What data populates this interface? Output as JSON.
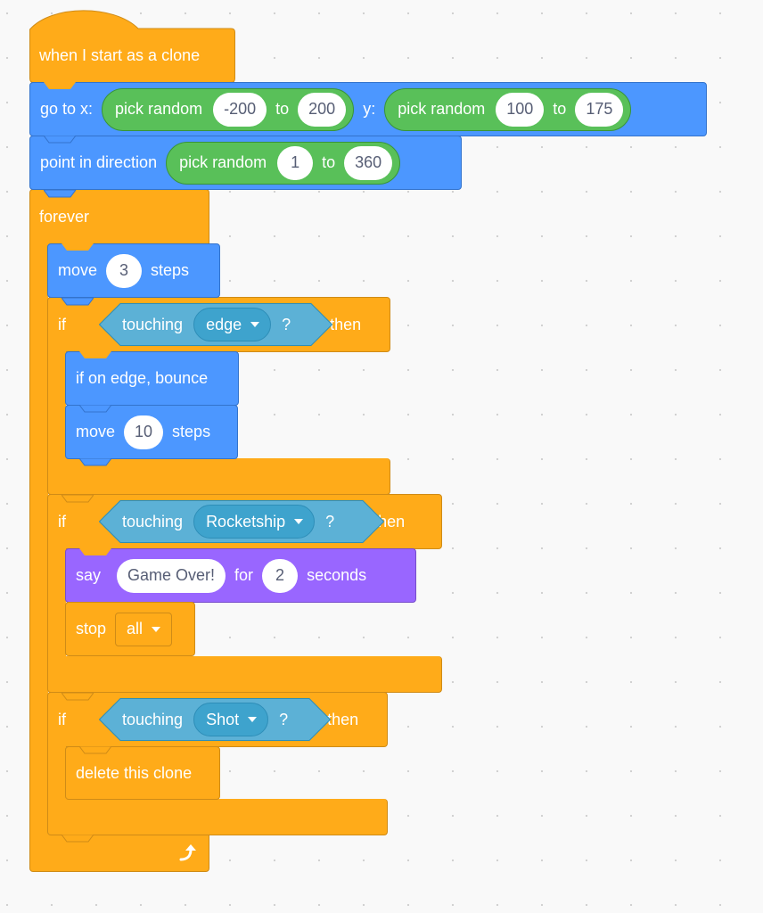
{
  "workspace": {
    "colors": {
      "events": "#ffab19",
      "motion": "#4c97ff",
      "operators": "#59c059",
      "sensing": "#5cb1d6",
      "looks": "#9966ff",
      "control": "#ffab19",
      "background": "#f9f9f9",
      "input_text": "#575e75"
    },
    "script": {
      "hat": {
        "label": "when I start as a clone"
      },
      "goto": {
        "label_x": "go to x:",
        "label_y": "y:",
        "x_reporter": {
          "label": "pick random",
          "from": "-200",
          "to_label": "to",
          "to": "200"
        },
        "y_reporter": {
          "label": "pick random",
          "from": "100",
          "to_label": "to",
          "to": "175"
        }
      },
      "point": {
        "label": "point in direction",
        "reporter": {
          "label": "pick random",
          "from": "1",
          "to_label": "to",
          "to": "360"
        }
      },
      "forever": {
        "label": "forever",
        "loop_icon": "loop-arrow-icon",
        "move": {
          "label": "move",
          "value": "3",
          "suffix": "steps"
        },
        "if1": {
          "if_label": "if",
          "then_label": "then",
          "condition": {
            "label": "touching",
            "target": "edge",
            "suffix": "?"
          },
          "bounce": {
            "label": "if on edge, bounce"
          },
          "move": {
            "label": "move",
            "value": "10",
            "suffix": "steps"
          }
        },
        "if2": {
          "if_label": "if",
          "then_label": "then",
          "condition": {
            "label": "touching",
            "target": "Rocketship",
            "suffix": "?"
          },
          "say": {
            "label": "say",
            "message": "Game Over!",
            "for_label": "for",
            "seconds": "2",
            "suffix": "seconds"
          },
          "stop": {
            "label": "stop",
            "option": "all"
          }
        },
        "if3": {
          "if_label": "if",
          "then_label": "then",
          "condition": {
            "label": "touching",
            "target": "Shot",
            "suffix": "?"
          },
          "delete": {
            "label": "delete this clone"
          }
        }
      }
    }
  }
}
